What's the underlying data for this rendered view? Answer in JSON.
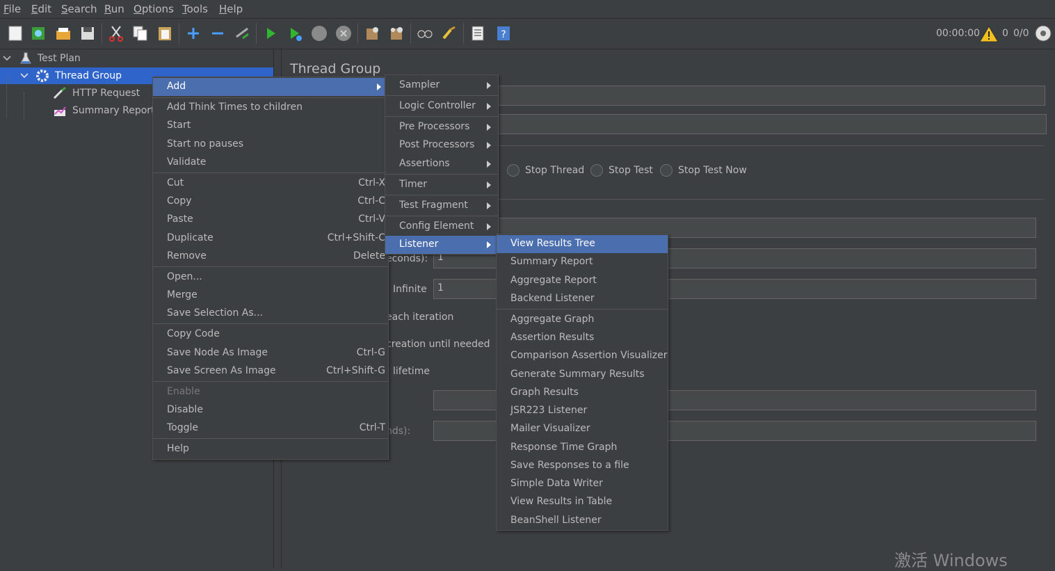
{
  "menubar": {
    "items": [
      {
        "u": "F",
        "rest": "ile"
      },
      {
        "u": "E",
        "rest": "dit"
      },
      {
        "u": "S",
        "rest": "earch"
      },
      {
        "u": "R",
        "rest": "un"
      },
      {
        "u": "O",
        "rest": "ptions"
      },
      {
        "u": "T",
        "rest": "ools"
      },
      {
        "u": "H",
        "rest": "elp"
      }
    ]
  },
  "toolbar": {
    "timer": "00:00:00",
    "warning_count": "0",
    "threads": "0/0"
  },
  "tree": {
    "test_plan": "Test Plan",
    "thread_group": "Thread Group",
    "http_request": "HTTP Request",
    "summary_report": "Summary Report"
  },
  "panel": {
    "title": "Thread Group",
    "radio_stop_thread": "Stop Thread",
    "radio_stop_test": "Stop Test",
    "radio_stop_test_now": "Stop Test Now",
    "label_seconds": "econds):",
    "value_rampup": "1",
    "label_infinite": "Infinite",
    "value_loop": "1",
    "label_each_iteration": "each iteration",
    "label_creation": "creation until needed",
    "label_lifetime": "lifetime",
    "label_nds": "nds):"
  },
  "context_menu": {
    "add": "Add",
    "add_think_times": "Add Think Times to children",
    "start": "Start",
    "start_no_pauses": "Start no pauses",
    "validate": "Validate",
    "cut": "Cut",
    "cut_acc": "Ctrl-X",
    "copy": "Copy",
    "copy_acc": "Ctrl-C",
    "paste": "Paste",
    "paste_acc": "Ctrl-V",
    "duplicate": "Duplicate",
    "duplicate_acc": "Ctrl+Shift-C",
    "remove": "Remove",
    "remove_acc": "Delete",
    "open": "Open...",
    "merge": "Merge",
    "save_selection": "Save Selection As...",
    "copy_code": "Copy Code",
    "save_node_image": "Save Node As Image",
    "save_node_image_acc": "Ctrl-G",
    "save_screen_image": "Save Screen As Image",
    "save_screen_image_acc": "Ctrl+Shift-G",
    "enable": "Enable",
    "disable": "Disable",
    "toggle": "Toggle",
    "toggle_acc": "Ctrl-T",
    "help": "Help"
  },
  "add_submenu": {
    "sampler": "Sampler",
    "logic_controller": "Logic Controller",
    "pre_processors": "Pre Processors",
    "post_processors": "Post Processors",
    "assertions": "Assertions",
    "timer": "Timer",
    "test_fragment": "Test Fragment",
    "config_element": "Config Element",
    "listener": "Listener"
  },
  "listener_submenu": {
    "items_top": [
      "View Results Tree",
      "Summary Report",
      "Aggregate Report",
      "Backend Listener"
    ],
    "items_bottom": [
      "Aggregate Graph",
      "Assertion Results",
      "Comparison Assertion Visualizer",
      "Generate Summary Results",
      "Graph Results",
      "JSR223 Listener",
      "Mailer Visualizer",
      "Response Time Graph",
      "Save Responses to a file",
      "Simple Data Writer",
      "View Results in Table",
      "BeanShell Listener"
    ]
  },
  "watermark": "激活 Windows",
  "colors": {
    "background": "#3c3f41",
    "selection": "#2f65ca",
    "menu_highlight": "#4b6eaf",
    "text": "#bbbbbb"
  }
}
